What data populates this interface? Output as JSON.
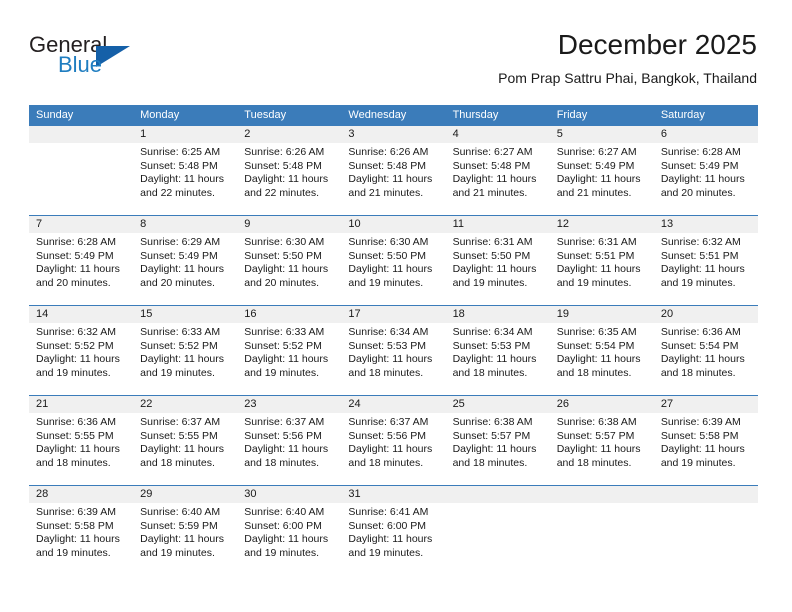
{
  "brand": {
    "word_one": "General",
    "word_two": "Blue",
    "triangle_icon": "triangle-icon"
  },
  "header": {
    "title": "December 2025",
    "subtitle": "Pom Prap Sattru Phai, Bangkok, Thailand"
  },
  "colors": {
    "header_blue": "#3b7cba",
    "brand_blue": "#1f7dc0",
    "triangle_blue": "#1560a8",
    "day_band_gray": "#f0f0f0",
    "text": "#1a1a1a"
  },
  "calendar": {
    "day_headers": [
      "Sunday",
      "Monday",
      "Tuesday",
      "Wednesday",
      "Thursday",
      "Friday",
      "Saturday"
    ],
    "weeks": [
      [
        {
          "day": "",
          "sunrise": "",
          "sunset": "",
          "daylight_line1": "",
          "daylight_line2": ""
        },
        {
          "day": "1",
          "sunrise": "Sunrise: 6:25 AM",
          "sunset": "Sunset: 5:48 PM",
          "daylight_line1": "Daylight: 11 hours",
          "daylight_line2": "and 22 minutes."
        },
        {
          "day": "2",
          "sunrise": "Sunrise: 6:26 AM",
          "sunset": "Sunset: 5:48 PM",
          "daylight_line1": "Daylight: 11 hours",
          "daylight_line2": "and 22 minutes."
        },
        {
          "day": "3",
          "sunrise": "Sunrise: 6:26 AM",
          "sunset": "Sunset: 5:48 PM",
          "daylight_line1": "Daylight: 11 hours",
          "daylight_line2": "and 21 minutes."
        },
        {
          "day": "4",
          "sunrise": "Sunrise: 6:27 AM",
          "sunset": "Sunset: 5:48 PM",
          "daylight_line1": "Daylight: 11 hours",
          "daylight_line2": "and 21 minutes."
        },
        {
          "day": "5",
          "sunrise": "Sunrise: 6:27 AM",
          "sunset": "Sunset: 5:49 PM",
          "daylight_line1": "Daylight: 11 hours",
          "daylight_line2": "and 21 minutes."
        },
        {
          "day": "6",
          "sunrise": "Sunrise: 6:28 AM",
          "sunset": "Sunset: 5:49 PM",
          "daylight_line1": "Daylight: 11 hours",
          "daylight_line2": "and 20 minutes."
        }
      ],
      [
        {
          "day": "7",
          "sunrise": "Sunrise: 6:28 AM",
          "sunset": "Sunset: 5:49 PM",
          "daylight_line1": "Daylight: 11 hours",
          "daylight_line2": "and 20 minutes."
        },
        {
          "day": "8",
          "sunrise": "Sunrise: 6:29 AM",
          "sunset": "Sunset: 5:49 PM",
          "daylight_line1": "Daylight: 11 hours",
          "daylight_line2": "and 20 minutes."
        },
        {
          "day": "9",
          "sunrise": "Sunrise: 6:30 AM",
          "sunset": "Sunset: 5:50 PM",
          "daylight_line1": "Daylight: 11 hours",
          "daylight_line2": "and 20 minutes."
        },
        {
          "day": "10",
          "sunrise": "Sunrise: 6:30 AM",
          "sunset": "Sunset: 5:50 PM",
          "daylight_line1": "Daylight: 11 hours",
          "daylight_line2": "and 19 minutes."
        },
        {
          "day": "11",
          "sunrise": "Sunrise: 6:31 AM",
          "sunset": "Sunset: 5:50 PM",
          "daylight_line1": "Daylight: 11 hours",
          "daylight_line2": "and 19 minutes."
        },
        {
          "day": "12",
          "sunrise": "Sunrise: 6:31 AM",
          "sunset": "Sunset: 5:51 PM",
          "daylight_line1": "Daylight: 11 hours",
          "daylight_line2": "and 19 minutes."
        },
        {
          "day": "13",
          "sunrise": "Sunrise: 6:32 AM",
          "sunset": "Sunset: 5:51 PM",
          "daylight_line1": "Daylight: 11 hours",
          "daylight_line2": "and 19 minutes."
        }
      ],
      [
        {
          "day": "14",
          "sunrise": "Sunrise: 6:32 AM",
          "sunset": "Sunset: 5:52 PM",
          "daylight_line1": "Daylight: 11 hours",
          "daylight_line2": "and 19 minutes."
        },
        {
          "day": "15",
          "sunrise": "Sunrise: 6:33 AM",
          "sunset": "Sunset: 5:52 PM",
          "daylight_line1": "Daylight: 11 hours",
          "daylight_line2": "and 19 minutes."
        },
        {
          "day": "16",
          "sunrise": "Sunrise: 6:33 AM",
          "sunset": "Sunset: 5:52 PM",
          "daylight_line1": "Daylight: 11 hours",
          "daylight_line2": "and 19 minutes."
        },
        {
          "day": "17",
          "sunrise": "Sunrise: 6:34 AM",
          "sunset": "Sunset: 5:53 PM",
          "daylight_line1": "Daylight: 11 hours",
          "daylight_line2": "and 18 minutes."
        },
        {
          "day": "18",
          "sunrise": "Sunrise: 6:34 AM",
          "sunset": "Sunset: 5:53 PM",
          "daylight_line1": "Daylight: 11 hours",
          "daylight_line2": "and 18 minutes."
        },
        {
          "day": "19",
          "sunrise": "Sunrise: 6:35 AM",
          "sunset": "Sunset: 5:54 PM",
          "daylight_line1": "Daylight: 11 hours",
          "daylight_line2": "and 18 minutes."
        },
        {
          "day": "20",
          "sunrise": "Sunrise: 6:36 AM",
          "sunset": "Sunset: 5:54 PM",
          "daylight_line1": "Daylight: 11 hours",
          "daylight_line2": "and 18 minutes."
        }
      ],
      [
        {
          "day": "21",
          "sunrise": "Sunrise: 6:36 AM",
          "sunset": "Sunset: 5:55 PM",
          "daylight_line1": "Daylight: 11 hours",
          "daylight_line2": "and 18 minutes."
        },
        {
          "day": "22",
          "sunrise": "Sunrise: 6:37 AM",
          "sunset": "Sunset: 5:55 PM",
          "daylight_line1": "Daylight: 11 hours",
          "daylight_line2": "and 18 minutes."
        },
        {
          "day": "23",
          "sunrise": "Sunrise: 6:37 AM",
          "sunset": "Sunset: 5:56 PM",
          "daylight_line1": "Daylight: 11 hours",
          "daylight_line2": "and 18 minutes."
        },
        {
          "day": "24",
          "sunrise": "Sunrise: 6:37 AM",
          "sunset": "Sunset: 5:56 PM",
          "daylight_line1": "Daylight: 11 hours",
          "daylight_line2": "and 18 minutes."
        },
        {
          "day": "25",
          "sunrise": "Sunrise: 6:38 AM",
          "sunset": "Sunset: 5:57 PM",
          "daylight_line1": "Daylight: 11 hours",
          "daylight_line2": "and 18 minutes."
        },
        {
          "day": "26",
          "sunrise": "Sunrise: 6:38 AM",
          "sunset": "Sunset: 5:57 PM",
          "daylight_line1": "Daylight: 11 hours",
          "daylight_line2": "and 18 minutes."
        },
        {
          "day": "27",
          "sunrise": "Sunrise: 6:39 AM",
          "sunset": "Sunset: 5:58 PM",
          "daylight_line1": "Daylight: 11 hours",
          "daylight_line2": "and 19 minutes."
        }
      ],
      [
        {
          "day": "28",
          "sunrise": "Sunrise: 6:39 AM",
          "sunset": "Sunset: 5:58 PM",
          "daylight_line1": "Daylight: 11 hours",
          "daylight_line2": "and 19 minutes."
        },
        {
          "day": "29",
          "sunrise": "Sunrise: 6:40 AM",
          "sunset": "Sunset: 5:59 PM",
          "daylight_line1": "Daylight: 11 hours",
          "daylight_line2": "and 19 minutes."
        },
        {
          "day": "30",
          "sunrise": "Sunrise: 6:40 AM",
          "sunset": "Sunset: 6:00 PM",
          "daylight_line1": "Daylight: 11 hours",
          "daylight_line2": "and 19 minutes."
        },
        {
          "day": "31",
          "sunrise": "Sunrise: 6:41 AM",
          "sunset": "Sunset: 6:00 PM",
          "daylight_line1": "Daylight: 11 hours",
          "daylight_line2": "and 19 minutes."
        },
        {
          "day": "",
          "sunrise": "",
          "sunset": "",
          "daylight_line1": "",
          "daylight_line2": ""
        },
        {
          "day": "",
          "sunrise": "",
          "sunset": "",
          "daylight_line1": "",
          "daylight_line2": ""
        },
        {
          "day": "",
          "sunrise": "",
          "sunset": "",
          "daylight_line1": "",
          "daylight_line2": ""
        }
      ]
    ]
  }
}
